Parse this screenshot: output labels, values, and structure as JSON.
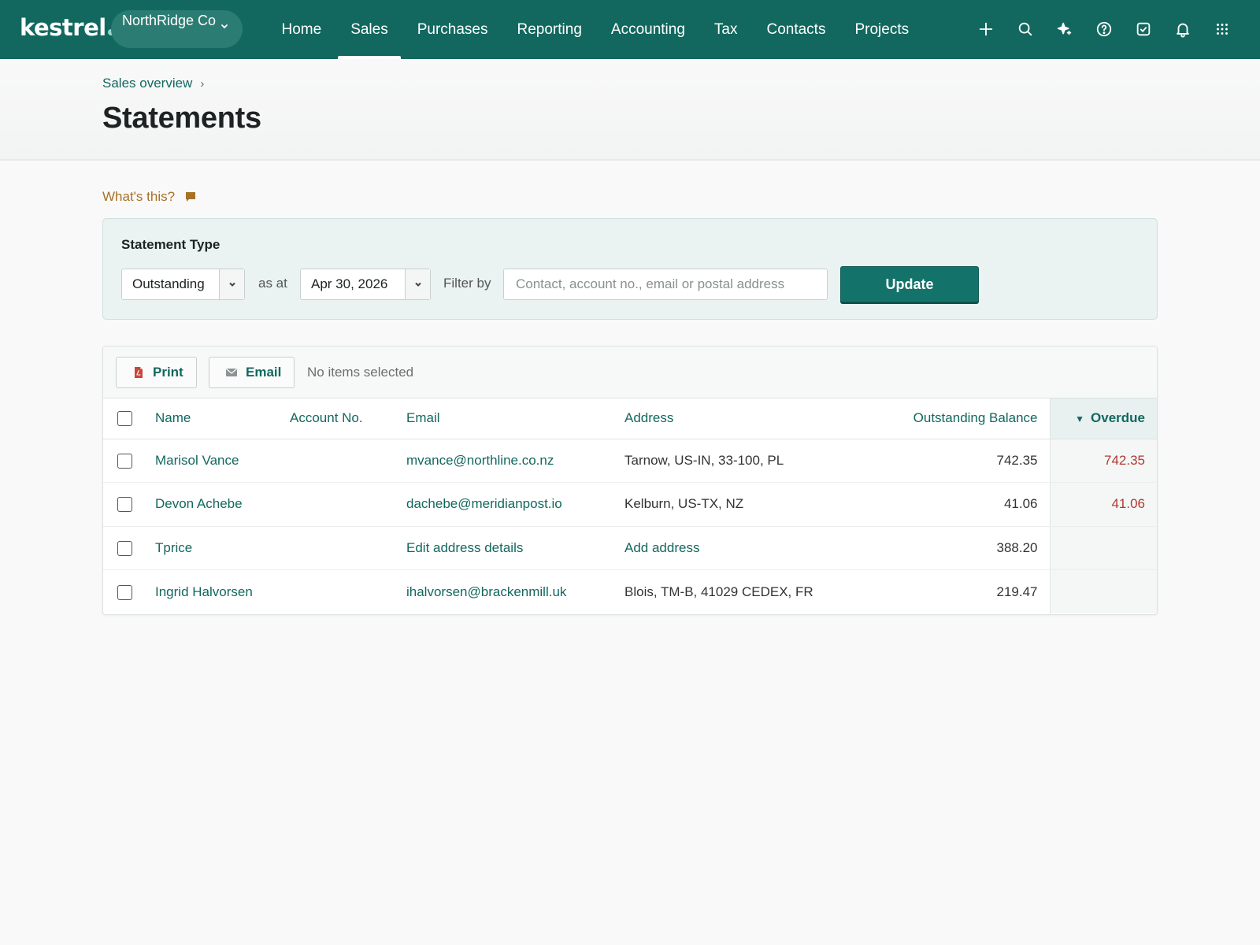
{
  "brand": {
    "name": "kestrel"
  },
  "org": {
    "name": "NorthRidge Co"
  },
  "nav": {
    "items": [
      {
        "label": "Home",
        "active": false
      },
      {
        "label": "Sales",
        "active": true
      },
      {
        "label": "Purchases",
        "active": false
      },
      {
        "label": "Reporting",
        "active": false
      },
      {
        "label": "Accounting",
        "active": false
      },
      {
        "label": "Tax",
        "active": false
      },
      {
        "label": "Contacts",
        "active": false
      },
      {
        "label": "Projects",
        "active": false
      }
    ],
    "icons": [
      "plus-icon",
      "search-icon",
      "sparkle-icon",
      "help-icon",
      "tasks-icon",
      "bell-icon",
      "apps-grid-icon"
    ]
  },
  "breadcrumb": {
    "parent": "Sales overview",
    "separator": "›"
  },
  "page": {
    "title": "Statements"
  },
  "help": {
    "label": "What's this?"
  },
  "filter": {
    "label": "Statement Type",
    "type_value": "Outstanding",
    "as_at_label": "as at",
    "date_value": "Apr 30, 2026",
    "filter_label": "Filter by",
    "search_placeholder": "Contact, account no., email or postal address",
    "search_value": "",
    "update_label": "Update"
  },
  "toolbar": {
    "print_label": "Print",
    "email_label": "Email",
    "selection_status": "No items selected"
  },
  "table": {
    "columns": {
      "name": "Name",
      "account": "Account No.",
      "email": "Email",
      "address": "Address",
      "balance": "Outstanding Balance",
      "overdue": "Overdue",
      "sort_indicator": "▼"
    },
    "rows": [
      {
        "name": "Marisol Vance",
        "account": "",
        "email": "mvance@northline.co.nz",
        "address": "Tarnow, US-IN, 33-100, PL",
        "balance": "742.35",
        "overdue": "742.35"
      },
      {
        "name": "Devon Achebe",
        "account": "",
        "email": "dachebe@meridianpost.io",
        "address": "Kelburn, US-TX, NZ",
        "balance": "41.06",
        "overdue": "41.06"
      },
      {
        "name": "Tprice",
        "account": "",
        "email": "Edit address details",
        "address": "Add address",
        "balance": "388.20",
        "overdue": ""
      },
      {
        "name": "Ingrid Halvorsen",
        "account": "",
        "email": "ihalvorsen@brackenmill.uk",
        "address": "Blois, TM-B, 41029 CEDEX, FR",
        "balance": "219.47",
        "overdue": ""
      }
    ]
  },
  "colors": {
    "brand": "#12685f",
    "overdue": "#b2382f",
    "help_link": "#a77227"
  }
}
